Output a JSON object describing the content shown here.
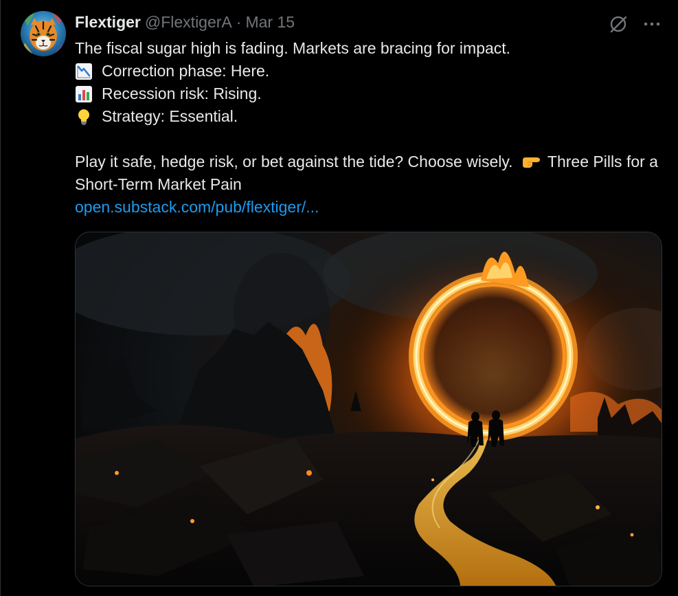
{
  "tweet": {
    "author": {
      "display_name": "Flextiger",
      "handle": "@FlextigerA",
      "separator": "·",
      "date": "Mar 15",
      "avatar_icon": "tiger-avatar"
    },
    "actions": {
      "grok_icon": "slash-circle-icon",
      "more_icon": "more-dots-icon"
    },
    "text": {
      "line1": "The fiscal sugar high is fading. Markets are bracing for impact.",
      "line2": "Correction phase: Here.",
      "line2_icon": "chart-decreasing-emoji",
      "line3": "Recession risk: Rising.",
      "line3_icon": "bar-chart-emoji",
      "line4": "Strategy: Essential.",
      "line4_icon": "light-bulb-emoji",
      "para_prefix": "Play it safe, hedge risk, or bet against the tide? Choose wisely.",
      "para_icon": "pointing-right-emoji",
      "para_suffix": "Three Pills for a Short-Term Market Pain",
      "link": "open.substack.com/pub/flextiger/..."
    },
    "media": {
      "type": "image",
      "description_icon": "burning-ring-landscape-image"
    },
    "colors": {
      "background": "#000000",
      "text": "#e7e9ea",
      "secondary": "#71767b",
      "link": "#1d9bf0",
      "border": "#2f3336"
    }
  }
}
